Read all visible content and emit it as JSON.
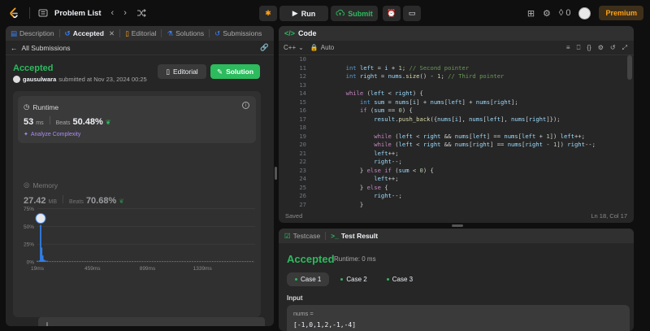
{
  "topbar": {
    "problem_list": "Problem List",
    "run": "Run",
    "submit": "Submit",
    "coins": "0",
    "premium": "Premium"
  },
  "left_tabs": [
    {
      "label": "Description",
      "icon": "document-icon"
    },
    {
      "label": "Accepted",
      "icon": "history-icon"
    },
    {
      "label": "Editorial",
      "icon": "book-icon"
    },
    {
      "label": "Solutions",
      "icon": "flask-icon"
    },
    {
      "label": "Submissions",
      "icon": "history-icon"
    }
  ],
  "submission": {
    "back_label": "All Submissions",
    "status": "Accepted",
    "user": "gausulwara",
    "submitted_at": "submitted at Nov 23, 2024 00:25",
    "editorial_btn": "Editorial",
    "solution_btn": "Solution"
  },
  "runtime": {
    "label": "Runtime",
    "value": "53",
    "unit": "ms",
    "beats_label": "Beats",
    "beats_value": "50.48%",
    "analyze": "Analyze Complexity"
  },
  "memory": {
    "label": "Memory",
    "value": "27.42",
    "unit": "MB",
    "beats_label": "Beats",
    "beats_value": "70.68%"
  },
  "chart_data": {
    "type": "bar",
    "ytick_labels": [
      "75%",
      "50%",
      "25%",
      "0%"
    ],
    "yticks": [
      75,
      50,
      25,
      0
    ],
    "xtick_labels": [
      "19ms",
      "459ms",
      "899ms",
      "1339ms"
    ],
    "xticks": [
      19,
      459,
      899,
      1339
    ],
    "xlim": [
      19,
      1760
    ],
    "ylim": [
      0,
      80
    ],
    "bars": [
      {
        "x": 19,
        "y": 1.5
      },
      {
        "x": 35,
        "y": 2
      },
      {
        "x": 45,
        "y": 52
      },
      {
        "x": 53,
        "y": 20
      },
      {
        "x": 62,
        "y": 9
      },
      {
        "x": 72,
        "y": 3
      },
      {
        "x": 85,
        "y": 2
      },
      {
        "x": 100,
        "y": 1.5
      },
      {
        "x": 120,
        "y": 1
      },
      {
        "x": 140,
        "y": 1
      },
      {
        "x": 160,
        "y": 1
      },
      {
        "x": 180,
        "y": 1
      },
      {
        "x": 200,
        "y": 1
      },
      {
        "x": 220,
        "y": 1
      },
      {
        "x": 240,
        "y": 1
      },
      {
        "x": 260,
        "y": 1
      },
      {
        "x": 280,
        "y": 1
      },
      {
        "x": 300,
        "y": 1
      },
      {
        "x": 320,
        "y": 1
      },
      {
        "x": 340,
        "y": 1
      },
      {
        "x": 360,
        "y": 1
      },
      {
        "x": 380,
        "y": 1
      },
      {
        "x": 400,
        "y": 1
      },
      {
        "x": 420,
        "y": 1
      },
      {
        "x": 440,
        "y": 1
      },
      {
        "x": 460,
        "y": 1
      },
      {
        "x": 480,
        "y": 1
      },
      {
        "x": 500,
        "y": 1
      },
      {
        "x": 520,
        "y": 1
      },
      {
        "x": 540,
        "y": 1
      },
      {
        "x": 560,
        "y": 1
      },
      {
        "x": 580,
        "y": 1
      },
      {
        "x": 600,
        "y": 1
      },
      {
        "x": 620,
        "y": 1
      },
      {
        "x": 640,
        "y": 1
      },
      {
        "x": 660,
        "y": 1
      },
      {
        "x": 680,
        "y": 1
      },
      {
        "x": 700,
        "y": 1
      },
      {
        "x": 720,
        "y": 1
      },
      {
        "x": 740,
        "y": 1
      },
      {
        "x": 760,
        "y": 1
      },
      {
        "x": 780,
        "y": 1
      },
      {
        "x": 800,
        "y": 1
      },
      {
        "x": 820,
        "y": 1
      },
      {
        "x": 840,
        "y": 1
      },
      {
        "x": 860,
        "y": 1
      },
      {
        "x": 880,
        "y": 1
      },
      {
        "x": 900,
        "y": 1
      },
      {
        "x": 920,
        "y": 1
      },
      {
        "x": 940,
        "y": 1
      },
      {
        "x": 960,
        "y": 1
      },
      {
        "x": 980,
        "y": 1
      },
      {
        "x": 1000,
        "y": 1
      },
      {
        "x": 1020,
        "y": 1
      },
      {
        "x": 1040,
        "y": 1
      },
      {
        "x": 1060,
        "y": 1
      },
      {
        "x": 1080,
        "y": 1
      },
      {
        "x": 1100,
        "y": 1
      },
      {
        "x": 1120,
        "y": 1
      },
      {
        "x": 1140,
        "y": 1
      },
      {
        "x": 1160,
        "y": 1
      },
      {
        "x": 1180,
        "y": 1
      },
      {
        "x": 1200,
        "y": 1
      },
      {
        "x": 1220,
        "y": 1
      },
      {
        "x": 1240,
        "y": 1
      },
      {
        "x": 1260,
        "y": 1
      },
      {
        "x": 1280,
        "y": 1
      },
      {
        "x": 1300,
        "y": 1
      },
      {
        "x": 1320,
        "y": 1
      },
      {
        "x": 1340,
        "y": 1
      },
      {
        "x": 1360,
        "y": 1
      },
      {
        "x": 1380,
        "y": 1
      },
      {
        "x": 1400,
        "y": 1
      },
      {
        "x": 1420,
        "y": 1
      },
      {
        "x": 1440,
        "y": 1
      },
      {
        "x": 1460,
        "y": 1
      },
      {
        "x": 1480,
        "y": 1
      },
      {
        "x": 1500,
        "y": 1
      },
      {
        "x": 1520,
        "y": 1
      },
      {
        "x": 1540,
        "y": 1
      },
      {
        "x": 1560,
        "y": 1
      },
      {
        "x": 1580,
        "y": 1
      },
      {
        "x": 1600,
        "y": 1
      },
      {
        "x": 1620,
        "y": 1
      },
      {
        "x": 1640,
        "y": 1
      },
      {
        "x": 1660,
        "y": 1
      },
      {
        "x": 1680,
        "y": 1
      },
      {
        "x": 1700,
        "y": 1
      },
      {
        "x": 1720,
        "y": 1
      },
      {
        "x": 1740,
        "y": 1
      }
    ],
    "highlight_x": 45,
    "grid": true,
    "bar_color": "#2f7fe8"
  },
  "overview": {
    "tick_labels": [
      "19ms",
      "459ms",
      "899ms",
      "1339ms"
    ]
  },
  "editor": {
    "title": "Code",
    "language": "C++",
    "autosave": "Auto",
    "saved": "Saved",
    "cursor": "Ln 18, Col 17",
    "lines": [
      {
        "n": "10",
        "html": ""
      },
      {
        "n": "11",
        "html": "        <span class='kw'>int</span> <span class='vr'>left</span> = <span class='vr'>i</span> + <span class='nm'>1</span>; <span class='cm'>// Second pointer</span>"
      },
      {
        "n": "12",
        "html": "        <span class='kw'>int</span> <span class='vr'>right</span> = <span class='vr'>nums</span>.<span class='fn'>size</span>() - <span class='nm'>1</span>; <span class='cm'>// Third pointer</span>"
      },
      {
        "n": "13",
        "html": ""
      },
      {
        "n": "14",
        "html": "        <span class='ctl'>while</span> (<span class='vr'>left</span> &lt; <span class='vr'>right</span>) {"
      },
      {
        "n": "15",
        "html": "            <span class='kw'>int</span> <span class='vr'>sum</span> = <span class='vr'>nums</span>[<span class='vr'>i</span>] + <span class='vr'>nums</span>[<span class='vr'>left</span>] + <span class='vr'>nums</span>[<span class='vr'>right</span>];"
      },
      {
        "n": "16",
        "html": "            <span class='ctl'>if</span> (<span class='vr'>sum</span> == <span class='nm'>0</span>) {"
      },
      {
        "n": "17",
        "html": "                <span class='vr'>result</span>.<span class='fn'>push_back</span>({<span class='vr'>nums</span>[<span class='vr'>i</span>], <span class='vr'>nums</span>[<span class='vr'>left</span>], <span class='vr'>nums</span>[<span class='vr'>right</span>]});"
      },
      {
        "n": "18",
        "html": ""
      },
      {
        "n": "19",
        "html": "                <span class='ctl'>while</span> (<span class='vr'>left</span> &lt; <span class='vr'>right</span> &amp;&amp; <span class='vr'>nums</span>[<span class='vr'>left</span>] == <span class='vr'>nums</span>[<span class='vr'>left</span> + <span class='nm'>1</span>]) <span class='vr'>left</span>++;"
      },
      {
        "n": "20",
        "html": "                <span class='ctl'>while</span> (<span class='vr'>left</span> &lt; <span class='vr'>right</span> &amp;&amp; <span class='vr'>nums</span>[<span class='vr'>right</span>] == <span class='vr'>nums</span>[<span class='vr'>right</span> - <span class='nm'>1</span>]) <span class='vr'>right</span>--;"
      },
      {
        "n": "21",
        "html": "                <span class='vr'>left</span>++;"
      },
      {
        "n": "22",
        "html": "                <span class='vr'>right</span>--;"
      },
      {
        "n": "23",
        "html": "            } <span class='ctl'>else if</span> (<span class='vr'>sum</span> &lt; <span class='nm'>0</span>) {"
      },
      {
        "n": "24",
        "html": "                <span class='vr'>left</span>++;"
      },
      {
        "n": "25",
        "html": "            } <span class='ctl'>else</span> {"
      },
      {
        "n": "26",
        "html": "                <span class='vr'>right</span>--;"
      },
      {
        "n": "27",
        "html": "            }"
      }
    ]
  },
  "test": {
    "tab_testcase": "Testcase",
    "tab_result": "Test Result",
    "status": "Accepted",
    "runtime": "Runtime: 0 ms",
    "cases": [
      "Case 1",
      "Case 2",
      "Case 3"
    ],
    "input_label": "Input",
    "var_name": "nums =",
    "var_value": "[-1,0,1,2,-1,-4]"
  }
}
